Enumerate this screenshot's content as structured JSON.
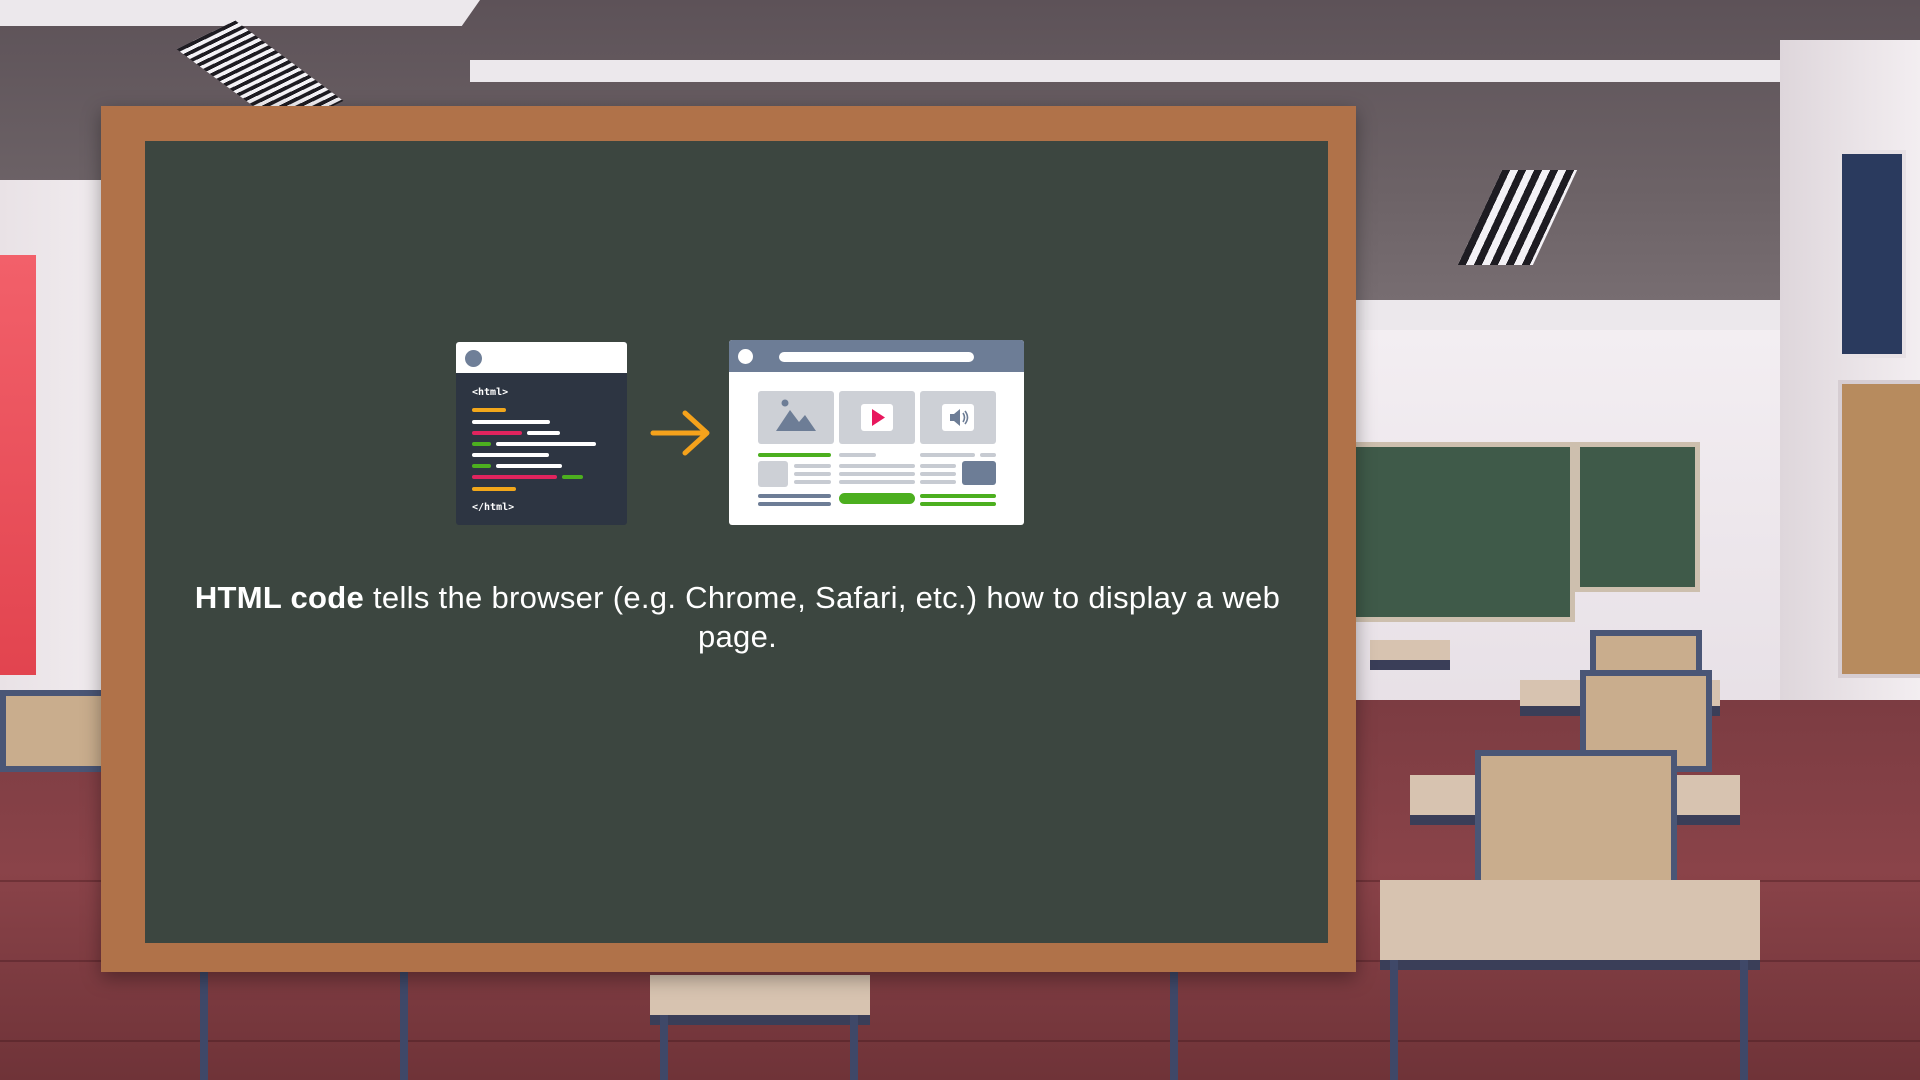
{
  "slide": {
    "caption_bold": "HTML code",
    "caption_rest": " tells the browser (e.g. Chrome, Safari, etc.) how to display a web page."
  },
  "code_panel": {
    "open_tag": "<html>",
    "close_tag": "</html>"
  },
  "colors": {
    "board": "#3c4640",
    "frame": "#b07249",
    "arrow": "#f5a21b",
    "code_yellow": "#f2a71b",
    "code_red": "#e0245e",
    "code_green": "#4caf1f",
    "browser_bar": "#6d7d96",
    "play_red": "#e8175d"
  },
  "icons": [
    "code-window-icon",
    "arrow-right-icon",
    "browser-window-icon",
    "image-icon",
    "play-icon",
    "speaker-icon"
  ]
}
